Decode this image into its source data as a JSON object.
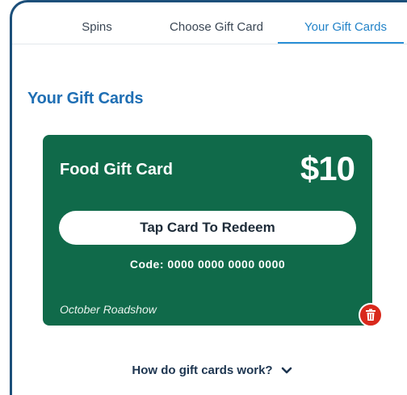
{
  "tabs": [
    {
      "label": "Spins"
    },
    {
      "label": "Choose Gift Card"
    },
    {
      "label": "Your Gift Cards",
      "active": true
    }
  ],
  "page_title": "Your Gift Cards",
  "card": {
    "name": "Food Gift Card",
    "amount": "$10",
    "redeem_label": "Tap Card To Redeem",
    "code_label": "Code:",
    "code_value": "0000 0000 0000 0000",
    "campaign": "October Roadshow",
    "color": "#106a4a"
  },
  "delete_icon": "trash-icon",
  "help_link": {
    "label": "How do gift cards work?",
    "icon": "chevron-down-icon"
  },
  "colors": {
    "accent": "#2383c8",
    "title": "#1f6fb4",
    "delete": "#d9291c"
  }
}
